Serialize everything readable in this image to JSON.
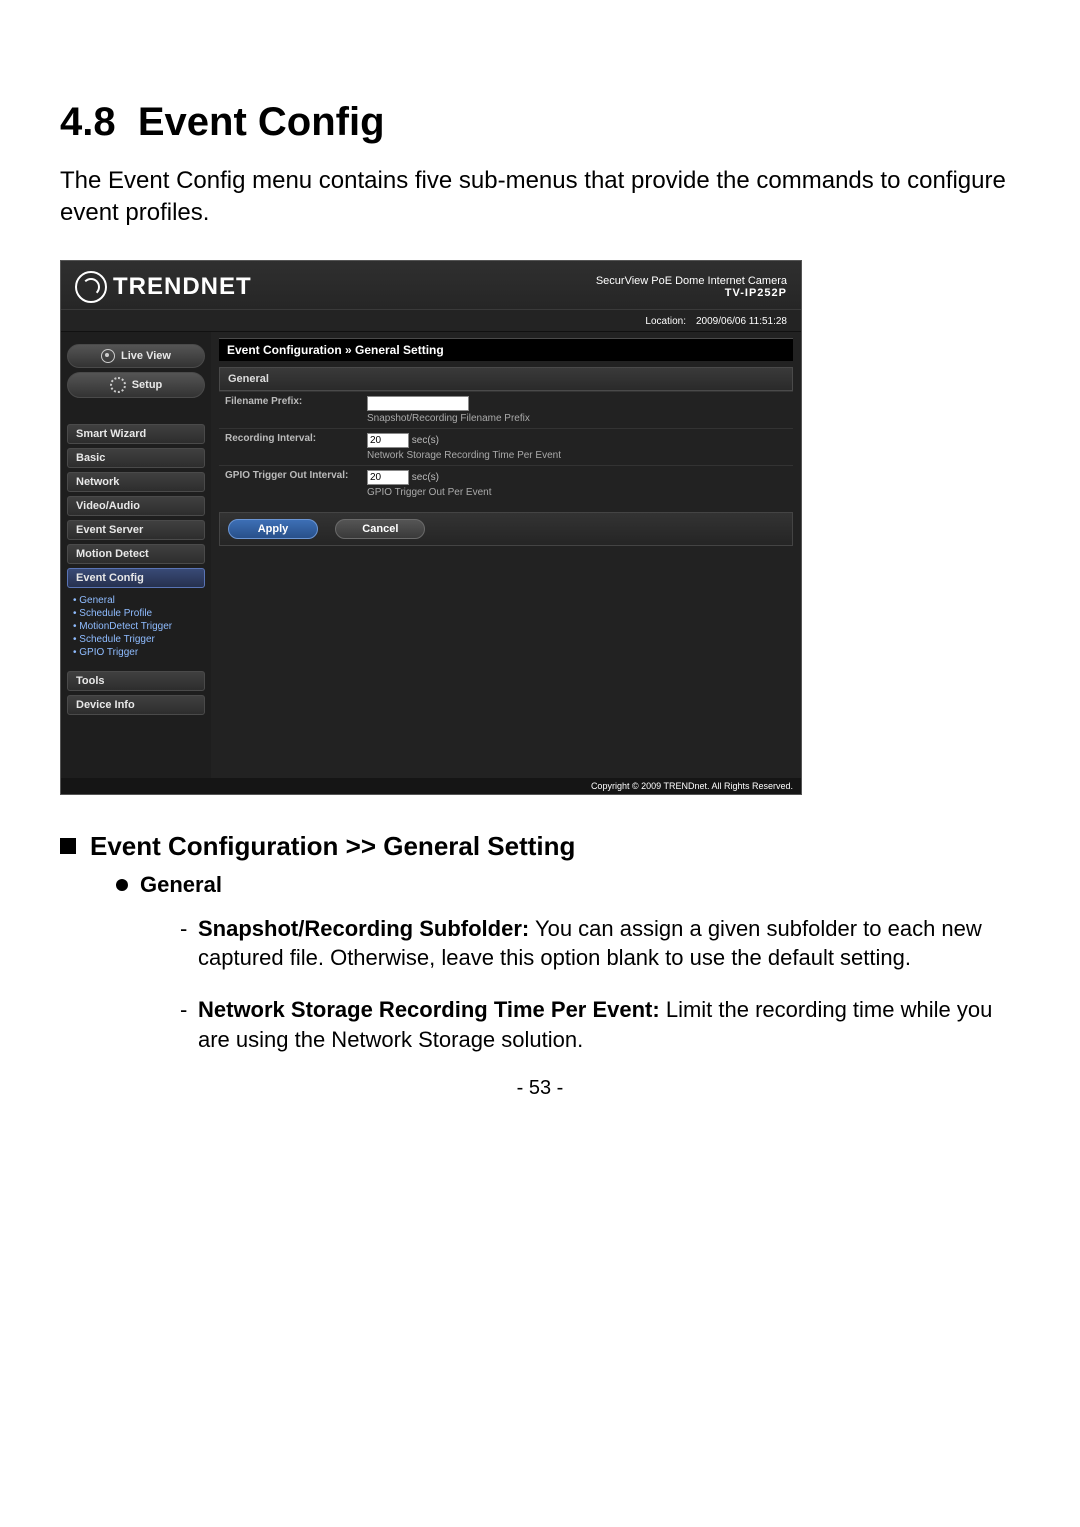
{
  "doc": {
    "section_number": "4.8",
    "section_title": "Event Config",
    "intro": "The Event Config menu contains five sub-menus that provide the commands to configure event profiles.",
    "sub_heading": "Event Configuration >> General Setting",
    "sub_sub_heading": "General",
    "bullets": [
      {
        "label": "Snapshot/Recording Subfolder:",
        "text": " You can assign a given subfolder to each new captured file. Otherwise, leave this option blank to use the default setting."
      },
      {
        "label": "Network Storage Recording Time Per Event:",
        "text": " Limit the recording time while you are using the Network Storage solution."
      }
    ],
    "page_number": "- 53 -"
  },
  "ui": {
    "brand": "TRENDNET",
    "product_line": "SecurView PoE Dome Internet Camera",
    "model": "TV-IP252P",
    "location_label": "Location:",
    "timestamp": "2009/06/06 11:51:28",
    "pills": {
      "live_view": "Live View",
      "setup": "Setup"
    },
    "sidebar": {
      "smart_wizard": "Smart Wizard",
      "basic": "Basic",
      "network": "Network",
      "video_audio": "Video/Audio",
      "event_server": "Event Server",
      "motion_detect": "Motion Detect",
      "event_config": "Event Config",
      "tools": "Tools",
      "device_info": "Device Info",
      "sub": {
        "general": "General",
        "schedule_profile": "Schedule Profile",
        "motion_trigger": "MotionDetect Trigger",
        "schedule_trigger": "Schedule Trigger",
        "gpio_trigger": "GPIO Trigger"
      }
    },
    "crumb": "Event Configuration » General Setting",
    "panel_title": "General",
    "form": {
      "filename_prefix_label": "Filename Prefix:",
      "filename_prefix_value": "",
      "filename_prefix_hint": "Snapshot/Recording Filename Prefix",
      "recording_interval_label": "Recording Interval:",
      "recording_interval_value": "20",
      "recording_interval_unit": "sec(s)",
      "recording_interval_hint": "Network Storage Recording Time Per Event",
      "gpio_interval_label": "GPIO Trigger Out Interval:",
      "gpio_interval_value": "20",
      "gpio_interval_unit": "sec(s)",
      "gpio_interval_hint": "GPIO Trigger Out Per Event"
    },
    "buttons": {
      "apply": "Apply",
      "cancel": "Cancel"
    },
    "copyright": "Copyright © 2009 TRENDnet. All Rights Reserved."
  }
}
